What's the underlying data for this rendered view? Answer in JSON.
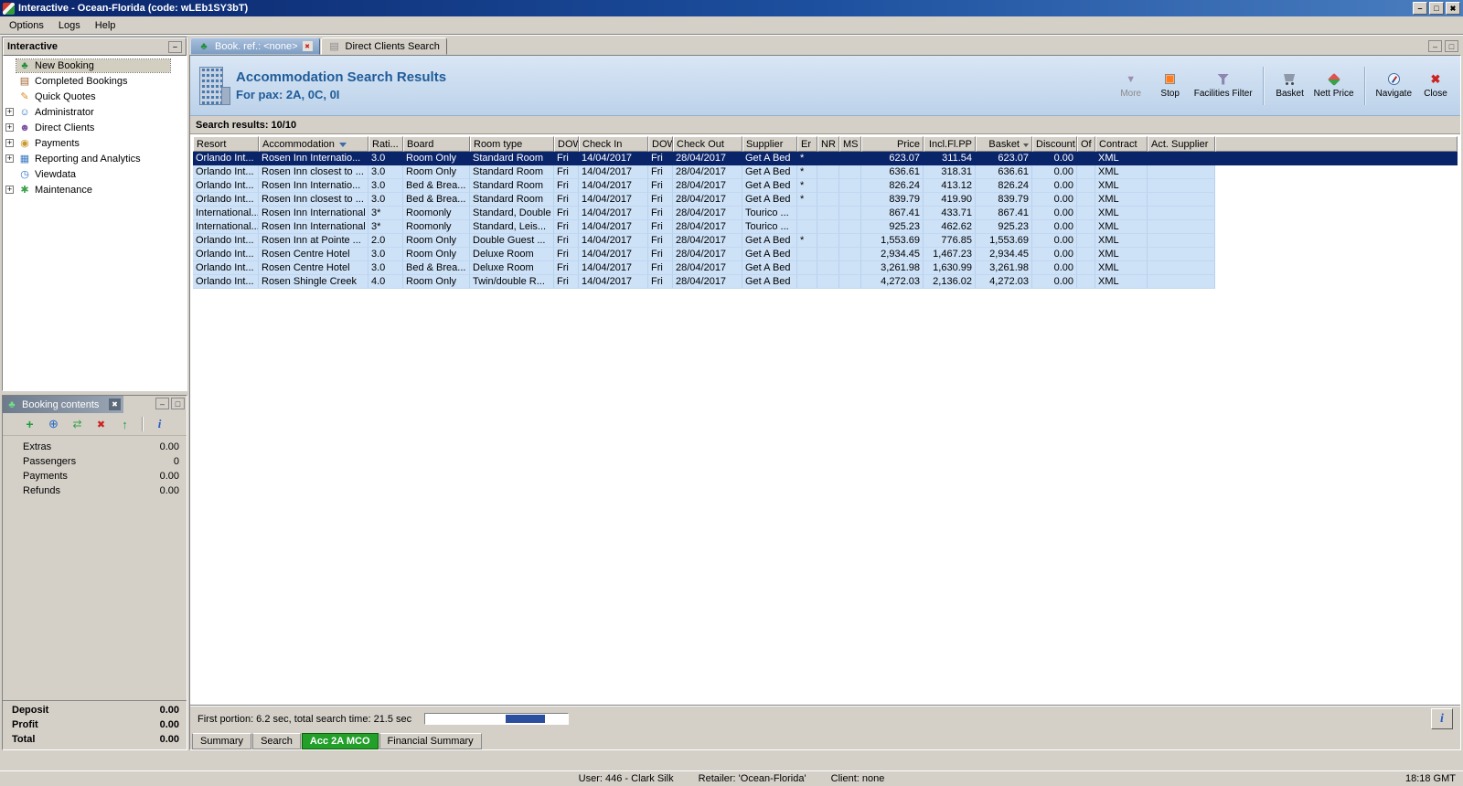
{
  "window": {
    "title": "Interactive - Ocean-Florida (code: wLEb1SY3bT)",
    "menu": [
      "Options",
      "Logs",
      "Help"
    ]
  },
  "sidebar": {
    "title": "Interactive",
    "items": [
      {
        "label": "New Booking",
        "icon": "palm-icon",
        "expandable": false,
        "selected": true
      },
      {
        "label": "Completed Bookings",
        "icon": "completed-icon",
        "expandable": false
      },
      {
        "label": "Quick Quotes",
        "icon": "quotes-icon",
        "expandable": false
      },
      {
        "label": "Administrator",
        "icon": "admin-icon",
        "expandable": true
      },
      {
        "label": "Direct Clients",
        "icon": "clients-icon",
        "expandable": true
      },
      {
        "label": "Payments",
        "icon": "payments-icon",
        "expandable": true
      },
      {
        "label": "Reporting and Analytics",
        "icon": "reporting-icon",
        "expandable": true
      },
      {
        "label": "Viewdata",
        "icon": "viewdata-icon",
        "expandable": false
      },
      {
        "label": "Maintenance",
        "icon": "maintenance-icon",
        "expandable": true
      }
    ]
  },
  "booking_contents": {
    "title": "Booking contents",
    "toolbar": [
      {
        "icon": "add-icon"
      },
      {
        "icon": "globe-icon"
      },
      {
        "icon": "transfer-icon"
      },
      {
        "icon": "delete-icon"
      },
      {
        "icon": "upload-icon"
      },
      {
        "separator": true
      },
      {
        "icon": "info-icon"
      }
    ],
    "items": [
      {
        "label": "Extras",
        "value": "0.00"
      },
      {
        "label": "Passengers",
        "value": "0"
      },
      {
        "label": "Payments",
        "value": "0.00"
      },
      {
        "label": "Refunds",
        "value": "0.00"
      }
    ],
    "totals": [
      {
        "label": "Deposit",
        "value": "0.00"
      },
      {
        "label": "Profit",
        "value": "0.00"
      },
      {
        "label": "Total",
        "value": "0.00"
      }
    ]
  },
  "main": {
    "tabs": [
      {
        "label": "Book. ref.: <none>",
        "icon": "palm-icon",
        "active": true,
        "closable": true
      },
      {
        "label": "Direct Clients Search",
        "icon": "dtab-icon",
        "active": false,
        "closable": false
      }
    ],
    "header": {
      "title": "Accommodation Search Results",
      "subtitle": "For pax: 2A, 0C, 0I"
    },
    "toolbar": [
      {
        "label": "More",
        "icon": "more-icon",
        "disabled": true
      },
      {
        "label": "Stop",
        "icon": "stop-icon"
      },
      {
        "label": "Facilities Filter",
        "icon": "facilities-filter-icon"
      },
      {
        "separator": true
      },
      {
        "label": "Basket",
        "icon": "basket-icon"
      },
      {
        "label": "Nett Price",
        "icon": "nett-price-icon"
      },
      {
        "separator": true
      },
      {
        "label": "Navigate",
        "icon": "navigate-icon"
      },
      {
        "label": "Close",
        "icon": "close-icon"
      }
    ],
    "results_label": "Search results: 10/10",
    "results_table": {
      "selected_row": 0,
      "columns": [
        "Resort",
        "Accommodation",
        "Rati...",
        "Board",
        "Room type",
        "DOW",
        "Check In",
        "DOW",
        "Check Out",
        "Supplier",
        "Er",
        "NR",
        "MS",
        "Price",
        "Incl.Fl.PP",
        "Basket",
        "Discount",
        "Of",
        "Contract",
        "Act. Supplier"
      ],
      "rows": [
        [
          "Orlando Int...",
          "Rosen Inn Internatio...",
          "3.0",
          "Room Only",
          "Standard Room",
          "Fri",
          "14/04/2017",
          "Fri",
          "28/04/2017",
          "Get A Bed",
          "*",
          "",
          "",
          "623.07",
          "311.54",
          "623.07",
          "0.00",
          "",
          "XML",
          ""
        ],
        [
          "Orlando Int...",
          "Rosen Inn closest to ...",
          "3.0",
          "Room Only",
          "Standard Room",
          "Fri",
          "14/04/2017",
          "Fri",
          "28/04/2017",
          "Get A Bed",
          "*",
          "",
          "",
          "636.61",
          "318.31",
          "636.61",
          "0.00",
          "",
          "XML",
          ""
        ],
        [
          "Orlando Int...",
          "Rosen Inn Internatio...",
          "3.0",
          "Bed & Brea...",
          "Standard Room",
          "Fri",
          "14/04/2017",
          "Fri",
          "28/04/2017",
          "Get A Bed",
          "*",
          "",
          "",
          "826.24",
          "413.12",
          "826.24",
          "0.00",
          "",
          "XML",
          ""
        ],
        [
          "Orlando Int...",
          "Rosen Inn closest to ...",
          "3.0",
          "Bed & Brea...",
          "Standard Room",
          "Fri",
          "14/04/2017",
          "Fri",
          "28/04/2017",
          "Get A Bed",
          "*",
          "",
          "",
          "839.79",
          "419.90",
          "839.79",
          "0.00",
          "",
          "XML",
          ""
        ],
        [
          "International...",
          "Rosen Inn International",
          "3*",
          "Roomonly",
          "Standard, Double",
          "Fri",
          "14/04/2017",
          "Fri",
          "28/04/2017",
          "Tourico ...",
          "",
          "",
          "",
          "867.41",
          "433.71",
          "867.41",
          "0.00",
          "",
          "XML",
          ""
        ],
        [
          "International...",
          "Rosen Inn International",
          "3*",
          "Roomonly",
          "Standard, Leis...",
          "Fri",
          "14/04/2017",
          "Fri",
          "28/04/2017",
          "Tourico ...",
          "",
          "",
          "",
          "925.23",
          "462.62",
          "925.23",
          "0.00",
          "",
          "XML",
          ""
        ],
        [
          "Orlando Int...",
          "Rosen Inn at Pointe ...",
          "2.0",
          "Room Only",
          "Double Guest ...",
          "Fri",
          "14/04/2017",
          "Fri",
          "28/04/2017",
          "Get A Bed",
          "*",
          "",
          "",
          "1,553.69",
          "776.85",
          "1,553.69",
          "0.00",
          "",
          "XML",
          ""
        ],
        [
          "Orlando Int...",
          "Rosen Centre Hotel",
          "3.0",
          "Room Only",
          "Deluxe Room",
          "Fri",
          "14/04/2017",
          "Fri",
          "28/04/2017",
          "Get A Bed",
          "",
          "",
          "",
          "2,934.45",
          "1,467.23",
          "2,934.45",
          "0.00",
          "",
          "XML",
          ""
        ],
        [
          "Orlando Int...",
          "Rosen Centre Hotel",
          "3.0",
          "Bed & Brea...",
          "Deluxe Room",
          "Fri",
          "14/04/2017",
          "Fri",
          "28/04/2017",
          "Get A Bed",
          "",
          "",
          "",
          "3,261.98",
          "1,630.99",
          "3,261.98",
          "0.00",
          "",
          "XML",
          ""
        ],
        [
          "Orlando Int...",
          "Rosen Shingle Creek",
          "4.0",
          "Room Only",
          "Twin/double R...",
          "Fri",
          "14/04/2017",
          "Fri",
          "28/04/2017",
          "Get A Bed",
          "",
          "",
          "",
          "4,272.03",
          "2,136.02",
          "4,272.03",
          "0.00",
          "",
          "XML",
          ""
        ]
      ]
    },
    "search_status": "First portion: 6.2 sec, total search time: 21.5 sec",
    "bottom_tabs": [
      {
        "label": "Summary",
        "active": false
      },
      {
        "label": "Search",
        "active": false
      },
      {
        "label": "Acc 2A MCO",
        "active": true
      },
      {
        "label": "Financial Summary",
        "active": false
      }
    ]
  },
  "statusbar": {
    "user": "User: 446 - Clark Silk",
    "retailer": "Retailer: 'Ocean-Florida'",
    "client": "Client: none",
    "time": "18:18 GMT"
  }
}
